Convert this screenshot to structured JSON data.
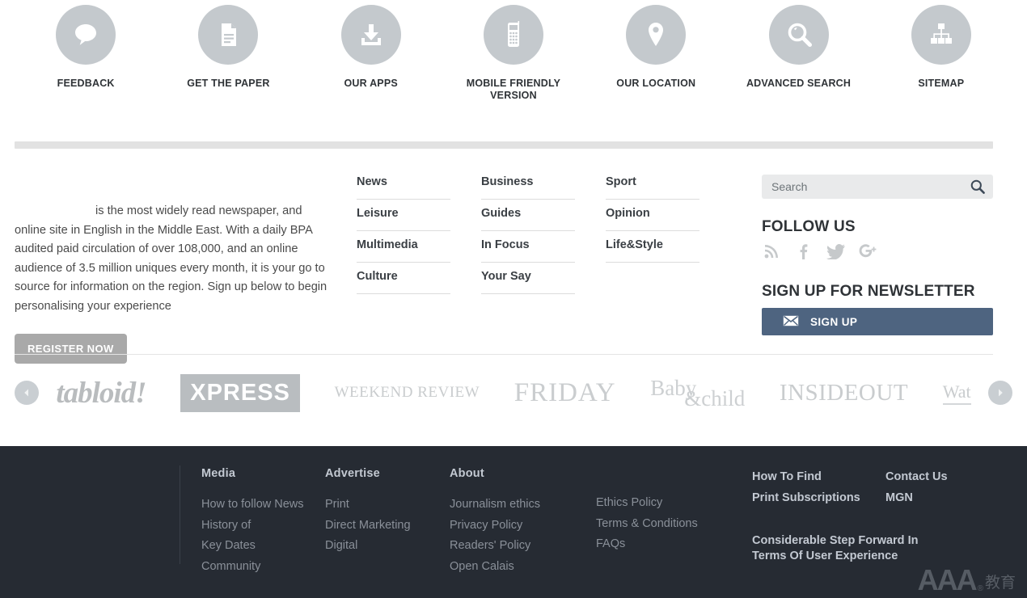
{
  "quicklinks": [
    {
      "icon": "speech-bubble-icon",
      "label": "FEEDBACK"
    },
    {
      "icon": "document-icon",
      "label": "GET THE PAPER"
    },
    {
      "icon": "download-icon",
      "label": "OUR APPS"
    },
    {
      "icon": "mobile-phone-icon",
      "label": "MOBILE FRIENDLY VERSION"
    },
    {
      "icon": "map-pin-icon",
      "label": "OUR LOCATION"
    },
    {
      "icon": "magnifier-icon",
      "label": "ADVANCED SEARCH"
    },
    {
      "icon": "sitemap-icon",
      "label": "SITEMAP"
    }
  ],
  "about": {
    "text": "is the most widely read newspaper, and online site in English in the Middle East. With a daily BPA audited paid circulation of over 108,000, and an online audience of 3.5 million uniques every month, it is your go to source for information on the region. Sign up below to begin personalising your experience",
    "register_label": "REGISTER NOW"
  },
  "nav": {
    "column1": [
      "News",
      "Leisure",
      "Multimedia",
      "Culture"
    ],
    "column2": [
      "Business",
      "Guides",
      "In Focus",
      "Your Say"
    ],
    "column3": [
      "Sport",
      "Opinion",
      "Life&Style"
    ]
  },
  "search": {
    "placeholder": "Search",
    "value": "",
    "icon": "magnifier-icon"
  },
  "follow": {
    "heading": "FOLLOW US",
    "icons": [
      "rss-icon",
      "facebook-icon",
      "twitter-icon",
      "google-plus-icon"
    ]
  },
  "newsletter": {
    "heading": "SIGN UP FOR NEWSLETTER",
    "button_label": "SIGN UP",
    "button_icon": "envelope-icon",
    "button_color": "#4e6480"
  },
  "carousel": {
    "prev_icon": "chevron-left-icon",
    "next_icon": "chevron-right-icon",
    "brands": [
      {
        "name": "tabloid!",
        "style": "tabloid"
      },
      {
        "name": "XPRESS",
        "style": "xpress"
      },
      {
        "name": "WEEKEND REVIEW",
        "style": "weekend"
      },
      {
        "name": "FRIDAY",
        "style": "friday"
      },
      {
        "name": "Baby",
        "name2": "&child",
        "style": "babychild"
      },
      {
        "name": "INSIDEOUT",
        "style": "insideout"
      },
      {
        "name": "Wat",
        "style": "wat"
      }
    ]
  },
  "footer": {
    "media": {
      "heading": "Media",
      "links": [
        "How to follow News",
        "History of",
        "Key Dates",
        "Community"
      ]
    },
    "advertise": {
      "heading": "Advertise",
      "links": [
        "Print",
        "Direct Marketing",
        "Digital"
      ]
    },
    "about": {
      "heading": "About",
      "links": [
        "Journalism ethics",
        "Privacy Policy",
        "Readers' Policy",
        "Open Calais"
      ]
    },
    "policies": {
      "links": [
        "Ethics Policy",
        "Terms & Conditions",
        "FAQs"
      ]
    },
    "howto": {
      "links": [
        "How To Find",
        "Print Subscriptions"
      ]
    },
    "contact": {
      "links": [
        "Contact Us",
        "MGN"
      ]
    },
    "tagline": "Considerable Step Forward In Terms Of User Experience",
    "watermark": {
      "latin": "AAA",
      "reg": "®",
      "cjk": "教育"
    },
    "background": "#262b33"
  }
}
